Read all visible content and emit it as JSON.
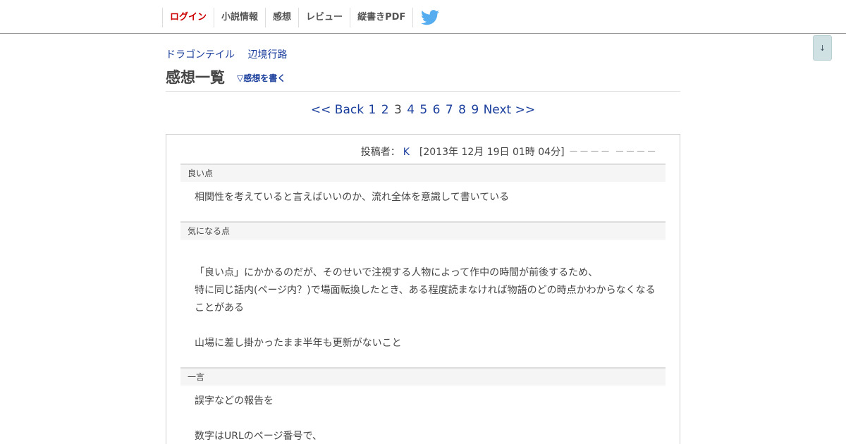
{
  "nav": {
    "items": [
      {
        "label": "ログイン",
        "kind": "login"
      },
      {
        "label": "小説情報"
      },
      {
        "label": "感想"
      },
      {
        "label": "レビュー"
      },
      {
        "label": "縦書きPDF"
      }
    ],
    "twitter_icon": "twitter-bird-icon",
    "twitter_color": "#55acee"
  },
  "scroll_button": {
    "label": "↓"
  },
  "breadcrumb": {
    "work_title": "ドラゴンテイル",
    "author": "辺境行路"
  },
  "heading": {
    "title": "感想一覧",
    "write_link": "▽感想を書く"
  },
  "pager": {
    "back": "<< Back",
    "pages": [
      "1",
      "2",
      "3",
      "4",
      "5",
      "6",
      "7",
      "8",
      "9"
    ],
    "current": "3",
    "next": "Next >>"
  },
  "review": {
    "poster_label": "投稿者：",
    "poster": "K",
    "date": "[2013年 12月 19日 01時 04分]",
    "dashes": "－－－－ －－－－",
    "sections": {
      "good": {
        "title": "良い点",
        "lines": [
          "相関性を考えていると言えばいいのか、流れ全体を意識して書いている"
        ]
      },
      "concern": {
        "title": "気になる点",
        "lines": [
          "「良い点」にかかるのだが、そのせいで注視する人物によって作中の時間が前後するため、",
          "特に同じ話内(ページ内？)で場面転換したとき、ある程度読まなければ物語のどの時点かわからなくなる",
          "ことがある",
          "山場に差し掛かったまま半年も更新がないこと"
        ]
      },
      "comment": {
        "title": "一言",
        "lines": [
          "誤字などの報告を",
          "数字はURLのページ番号で、"
        ]
      }
    }
  },
  "colors": {
    "link": "#1a3e9c",
    "login": "#cc0000",
    "text": "#444444"
  }
}
